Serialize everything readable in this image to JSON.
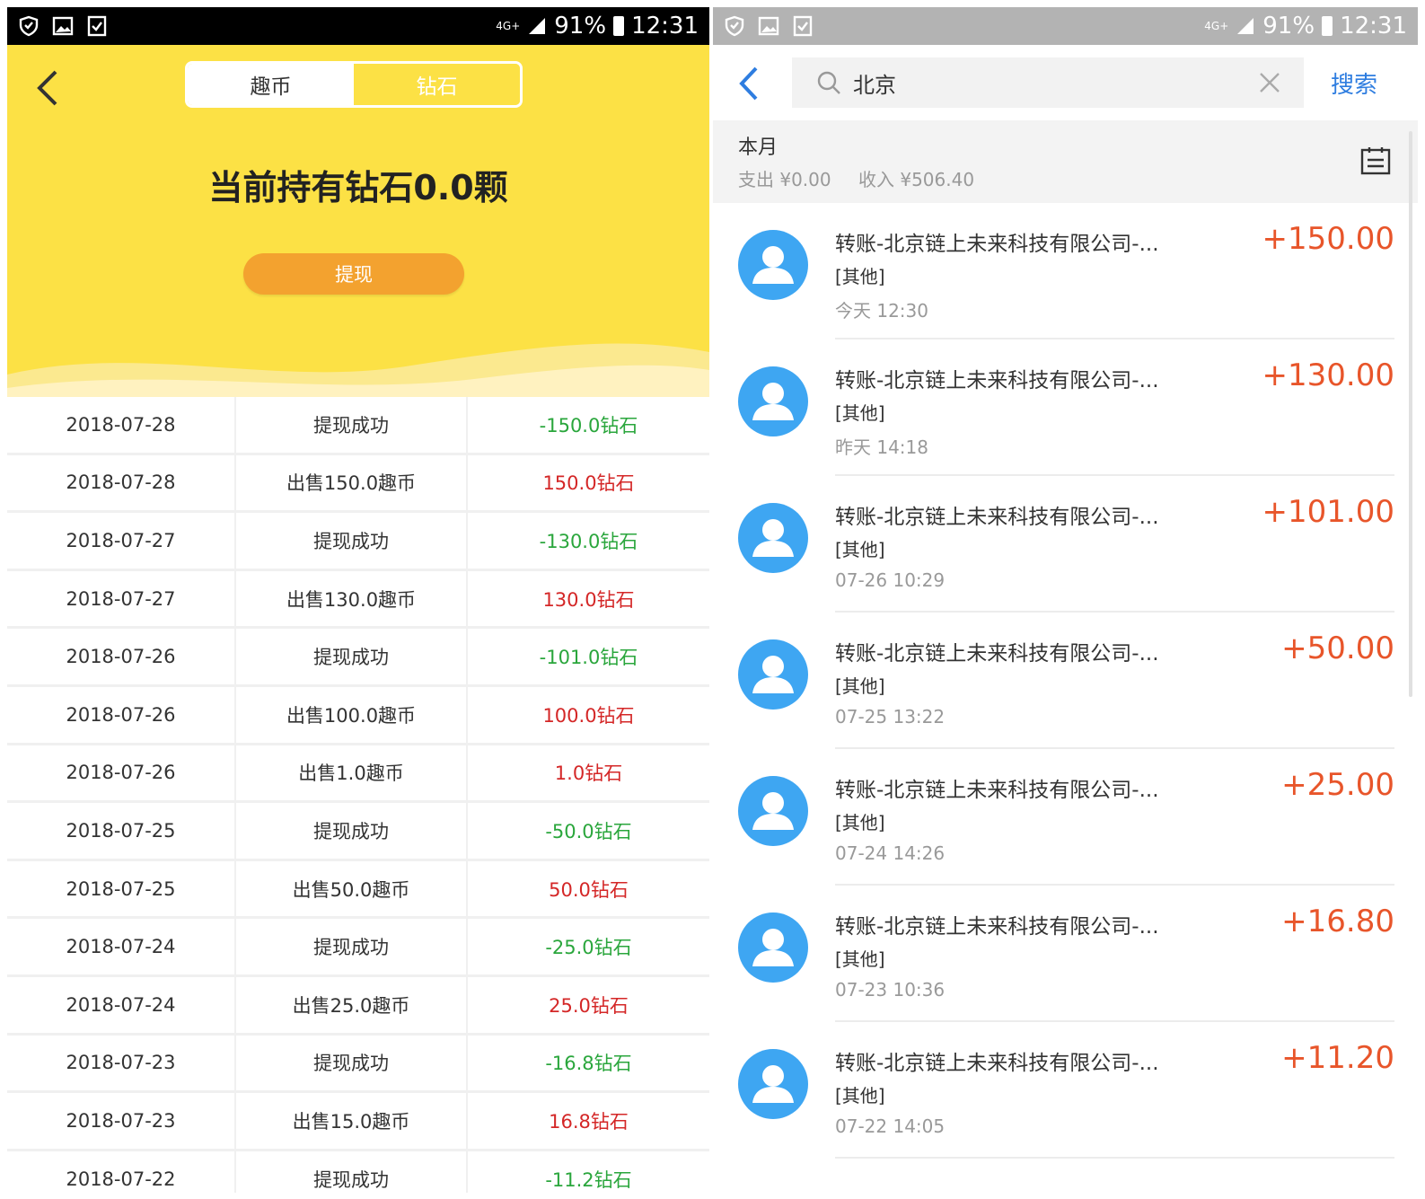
{
  "status_bar": {
    "network": "4G+",
    "battery": "91%",
    "time": "12:31"
  },
  "left": {
    "tabs": [
      "趣币",
      "钻石"
    ],
    "holding": "当前持有钻石0.0颗",
    "withdraw_label": "提现",
    "records": [
      {
        "date": "2018-07-28",
        "desc": "提现成功",
        "amount": "-150.0钻石",
        "type": "neg"
      },
      {
        "date": "2018-07-28",
        "desc": "出售150.0趣币",
        "amount": "150.0钻石",
        "type": "pos"
      },
      {
        "date": "2018-07-27",
        "desc": "提现成功",
        "amount": "-130.0钻石",
        "type": "neg"
      },
      {
        "date": "2018-07-27",
        "desc": "出售130.0趣币",
        "amount": "130.0钻石",
        "type": "pos"
      },
      {
        "date": "2018-07-26",
        "desc": "提现成功",
        "amount": "-101.0钻石",
        "type": "neg"
      },
      {
        "date": "2018-07-26",
        "desc": "出售100.0趣币",
        "amount": "100.0钻石",
        "type": "pos"
      },
      {
        "date": "2018-07-26",
        "desc": "出售1.0趣币",
        "amount": "1.0钻石",
        "type": "pos"
      },
      {
        "date": "2018-07-25",
        "desc": "提现成功",
        "amount": "-50.0钻石",
        "type": "neg"
      },
      {
        "date": "2018-07-25",
        "desc": "出售50.0趣币",
        "amount": "50.0钻石",
        "type": "pos"
      },
      {
        "date": "2018-07-24",
        "desc": "提现成功",
        "amount": "-25.0钻石",
        "type": "neg"
      },
      {
        "date": "2018-07-24",
        "desc": "出售25.0趣币",
        "amount": "25.0钻石",
        "type": "pos"
      },
      {
        "date": "2018-07-23",
        "desc": "提现成功",
        "amount": "-16.8钻石",
        "type": "neg"
      },
      {
        "date": "2018-07-23",
        "desc": "出售15.0趣币",
        "amount": "16.8钻石",
        "type": "pos"
      },
      {
        "date": "2018-07-22",
        "desc": "提现成功",
        "amount": "-11.2钻石",
        "type": "neg"
      }
    ]
  },
  "right": {
    "search_value": "北京",
    "search_button": "搜索",
    "month_title": "本月",
    "expense": "支出 ¥0.00",
    "income": "收入 ¥506.40",
    "transactions": [
      {
        "title": "转账-北京链上未来科技有限公司-...",
        "category": "[其他]",
        "time": "今天  12:30",
        "amount": "+150.00"
      },
      {
        "title": "转账-北京链上未来科技有限公司-...",
        "category": "[其他]",
        "time": "昨天  14:18",
        "amount": "+130.00"
      },
      {
        "title": "转账-北京链上未来科技有限公司-...",
        "category": "[其他]",
        "time": "07-26  10:29",
        "amount": "+101.00"
      },
      {
        "title": "转账-北京链上未来科技有限公司-...",
        "category": "[其他]",
        "time": "07-25  13:22",
        "amount": "+50.00"
      },
      {
        "title": "转账-北京链上未来科技有限公司-...",
        "category": "[其他]",
        "time": "07-24  14:26",
        "amount": "+25.00"
      },
      {
        "title": "转账-北京链上未来科技有限公司-...",
        "category": "[其他]",
        "time": "07-23  10:36",
        "amount": "+16.80"
      },
      {
        "title": "转账-北京链上未来科技有限公司-...",
        "category": "[其他]",
        "time": "07-22  14:05",
        "amount": "+11.20"
      }
    ]
  }
}
